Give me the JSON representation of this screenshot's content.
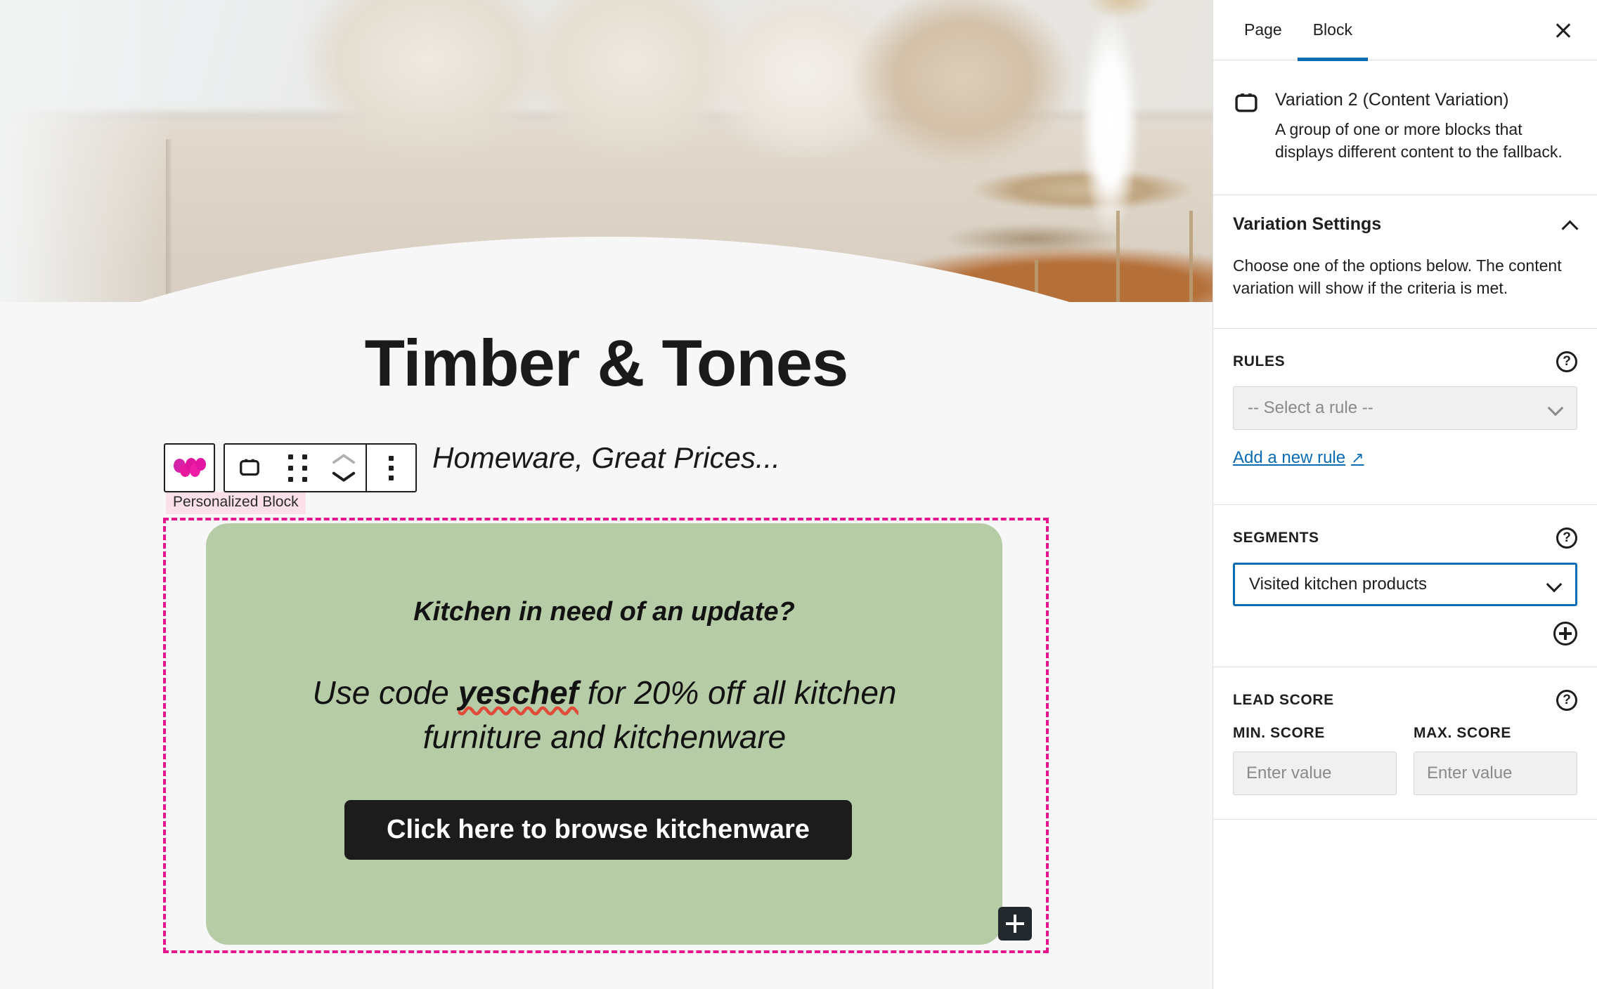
{
  "editor": {
    "site_title": "Timber & Tones",
    "site_tagline": "Homeware, Great Prices...",
    "block_label": "Personalized Block",
    "toolbar": {
      "logo_label": "Personalization plugin",
      "block_type_label": "Group block",
      "drag_label": "Drag",
      "move_up_label": "Move up",
      "move_down_label": "Move down",
      "options_label": "Options"
    },
    "variation_block": {
      "heading": "Kitchen in need of an update?",
      "body_prefix": "Use code ",
      "body_code": "yeschef",
      "body_suffix": " for 20% off all kitchen furniture and kitchenware",
      "cta_label": "Click here to browse kitchenware",
      "appender_label": "Add block",
      "background_color": "#b6cca7",
      "outline_color": "#e6158f",
      "cta_background": "#1c1c1c"
    }
  },
  "sidebar": {
    "tabs": [
      {
        "label": "Page",
        "active": false
      },
      {
        "label": "Block",
        "active": true
      }
    ],
    "close_label": "Close settings",
    "block_card": {
      "title": "Variation 2 (Content Variation)",
      "description": "A group of one or more blocks that displays different content to the fallback."
    },
    "panel": {
      "title": "Variation Settings",
      "description": "Choose one of the options below. The content variation will show if the criteria is met."
    },
    "rules": {
      "label": "RULES",
      "help_label": "Help",
      "select_value": "-- Select a rule --",
      "add_link": "Add a new rule",
      "add_link_icon": "↗"
    },
    "segments": {
      "label": "SEGMENTS",
      "help_label": "Help",
      "select_value": "Visited kitchen products",
      "add_label": "Add segment"
    },
    "lead_score": {
      "label": "LEAD SCORE",
      "help_label": "Help",
      "min_label": "MIN. SCORE",
      "min_value": "",
      "min_placeholder": "Enter value",
      "max_label": "MAX. SCORE",
      "max_value": "",
      "max_placeholder": "Enter value"
    },
    "accent_color": "#0a6cb3"
  }
}
